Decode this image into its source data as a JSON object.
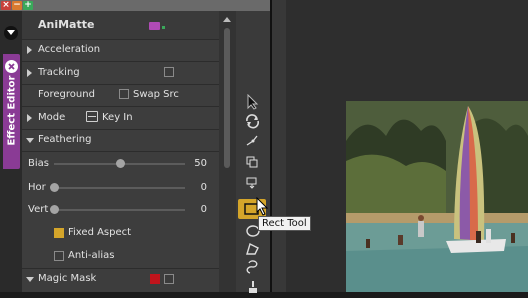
{
  "window": {
    "controls": [
      "×",
      "−",
      "+"
    ],
    "control_colors": [
      "#c8413a",
      "#d97a2f",
      "#3aa85a"
    ]
  },
  "side_tab": {
    "label": "Effect Editor",
    "color": "#8a3b95"
  },
  "effect": {
    "name": "AniMatte",
    "badge_color": "#b04bb5"
  },
  "sections": {
    "acceleration": "Acceleration",
    "tracking": "Tracking",
    "foreground": "Foreground",
    "swap_src": "Swap Src",
    "mode": "Mode",
    "mode_value": "Key In",
    "feathering": "Feathering",
    "fixed_aspect": "Fixed Aspect",
    "anti_alias": "Anti-alias",
    "magic_mask": "Magic Mask"
  },
  "sliders": [
    {
      "label": "Bias",
      "value": "50",
      "level": 0.5
    },
    {
      "label": "Hor",
      "value": "0",
      "level": 0
    },
    {
      "label": "Vert",
      "value": "0",
      "level": 0
    }
  ],
  "colors": {
    "fixed_aspect_swatch": "#d4a52a",
    "magic_mask_swatch": "#c0141c",
    "active_tool": "#d4a52a"
  },
  "tools": [
    "select-arrow",
    "rotate",
    "scale",
    "copy",
    "paste",
    "rect",
    "oval",
    "freehand",
    "brush-lasso",
    "brush"
  ],
  "tooltip": "Rect Tool"
}
